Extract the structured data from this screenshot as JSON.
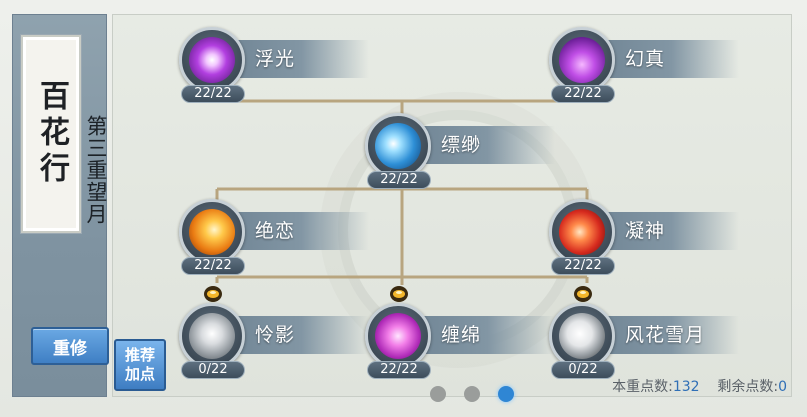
{
  "sect": {
    "title": "百花行",
    "tier": "第三重望月"
  },
  "buttons": {
    "reset": "重修",
    "recommend_line1": "推荐",
    "recommend_line2": "加点"
  },
  "skills": [
    {
      "name": "浮光",
      "level": "22/22",
      "icon": "purple-burst-icon"
    },
    {
      "name": "幻真",
      "level": "22/22",
      "icon": "violet-sparkles-icon"
    },
    {
      "name": "缥缈",
      "level": "22/22",
      "icon": "blue-wave-icon"
    },
    {
      "name": "绝恋",
      "level": "22/22",
      "icon": "gold-strike-icon"
    },
    {
      "name": "凝神",
      "level": "22/22",
      "icon": "crimson-blade-icon"
    },
    {
      "name": "怜影",
      "level": "0/22",
      "icon": "grey-mist-icon"
    },
    {
      "name": "缠绵",
      "level": "22/22",
      "icon": "pink-petals-icon"
    },
    {
      "name": "风花雪月",
      "level": "0/22",
      "icon": "moon-icon"
    }
  ],
  "points": {
    "used_label": "本重点数:",
    "used_value": "132",
    "remaining_label": "剩余点数:",
    "remaining_value": "0"
  },
  "pagination": {
    "total": 3,
    "active": 3
  },
  "colors": {
    "accent": "#3f7fc4",
    "connector": "#b8a57f",
    "skill_bar": "#7a8e9c"
  }
}
